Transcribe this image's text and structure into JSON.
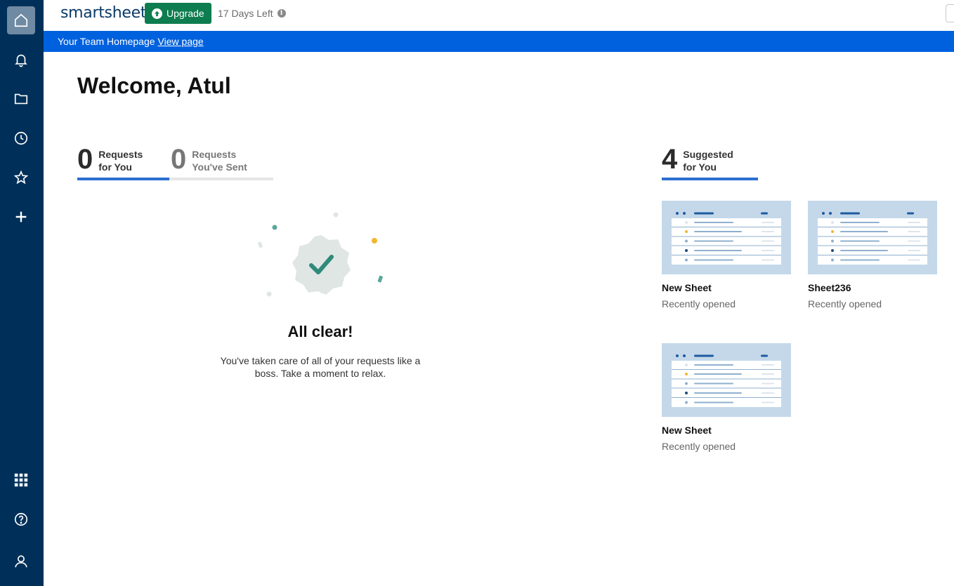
{
  "header": {
    "logo": "smartsheet",
    "upgrade_label": "Upgrade",
    "trial_text": "17 Days Left"
  },
  "banner": {
    "text": "Your Team Homepage",
    "link": "View page"
  },
  "welcome": "Welcome, Atul",
  "request_tabs": [
    {
      "count": "0",
      "line1": "Requests",
      "line2": "for You"
    },
    {
      "count": "0",
      "line1": "Requests",
      "line2": "You've Sent"
    }
  ],
  "empty_state": {
    "title": "All clear!",
    "message": "You've taken care of all of your requests like a boss. Take a moment to relax."
  },
  "suggested": {
    "count": "4",
    "line1": "Suggested",
    "line2": "for You",
    "cards": [
      {
        "name": "New Sheet",
        "subtitle": "Recently opened"
      },
      {
        "name": "Sheet236",
        "subtitle": "Recently opened"
      },
      {
        "name": "New Sheet",
        "subtitle": "Recently opened"
      }
    ]
  },
  "sidebar": {
    "items": [
      "home-icon",
      "bell-icon",
      "folder-icon",
      "clock-icon",
      "star-icon",
      "plus-icon"
    ],
    "bottom_items": [
      "apps-grid-icon",
      "help-icon",
      "account-icon"
    ]
  },
  "colors": {
    "rail": "#003059",
    "banner": "#0061de",
    "upgrade": "#0d7d4f",
    "tab_active": "#2b6fd0"
  }
}
